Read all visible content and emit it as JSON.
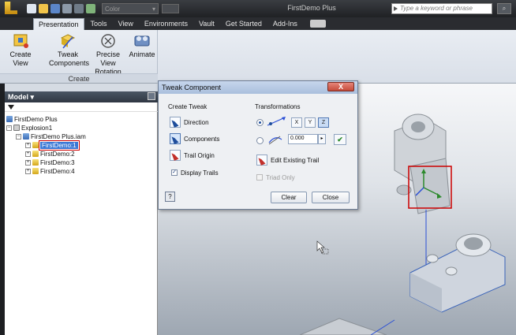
{
  "titlebar": {
    "title": "FirstDemo Plus",
    "color_combo": "Color",
    "search_placeholder": "Type a keyword or phrase"
  },
  "tabs": [
    "Presentation",
    "Tools",
    "View",
    "Environments",
    "Vault",
    "Get Started",
    "Add-Ins"
  ],
  "ribbon": {
    "group_label": "Create",
    "buttons": [
      {
        "label": "Create View",
        "icon": "create-view-icon"
      },
      {
        "label": "Tweak Components",
        "icon": "tweak-components-icon"
      },
      {
        "label": "Precise View Rotation",
        "icon": "precise-view-rotation-icon"
      },
      {
        "label": "Animate",
        "icon": "animate-icon"
      }
    ]
  },
  "browser": {
    "header": "Model",
    "tree": [
      {
        "label": "FirstDemo Plus",
        "level": 0,
        "icon": "presentation-icon"
      },
      {
        "label": "Explosion1",
        "level": 1,
        "icon": "explosion-icon"
      },
      {
        "label": "FirstDemo Plus.iam",
        "level": 2,
        "icon": "assembly-icon"
      },
      {
        "label": "FirstDemo:1",
        "level": 3,
        "icon": "part-icon",
        "selected": true
      },
      {
        "label": "FirstDemo:2",
        "level": 3,
        "icon": "part-icon"
      },
      {
        "label": "FirstDemo:3",
        "level": 3,
        "icon": "part-icon"
      },
      {
        "label": "FirstDemo:4",
        "level": 3,
        "icon": "part-icon"
      }
    ]
  },
  "dialog": {
    "title": "Tweak Component",
    "close": "X",
    "create_tweak": {
      "title": "Create Tweak",
      "direction": "Direction",
      "components": "Components",
      "trail_origin": "Trail Origin",
      "display_trails": "Display Trails",
      "display_trails_checked": true
    },
    "transformations": {
      "title": "Transformations",
      "axis_x": "X",
      "axis_y": "Y",
      "axis_z": "Z",
      "active_axis": "Z",
      "mode": "linear",
      "value": "0.000",
      "edit_existing_trail": "Edit Existing Trail",
      "triad_only": "Triad Only"
    },
    "clear": "Clear",
    "close_button": "Close",
    "help": "?"
  },
  "colors": {
    "accent": "#3a78d6",
    "selection_box": "#cc0000",
    "trail_line": "#2a4fd6"
  }
}
